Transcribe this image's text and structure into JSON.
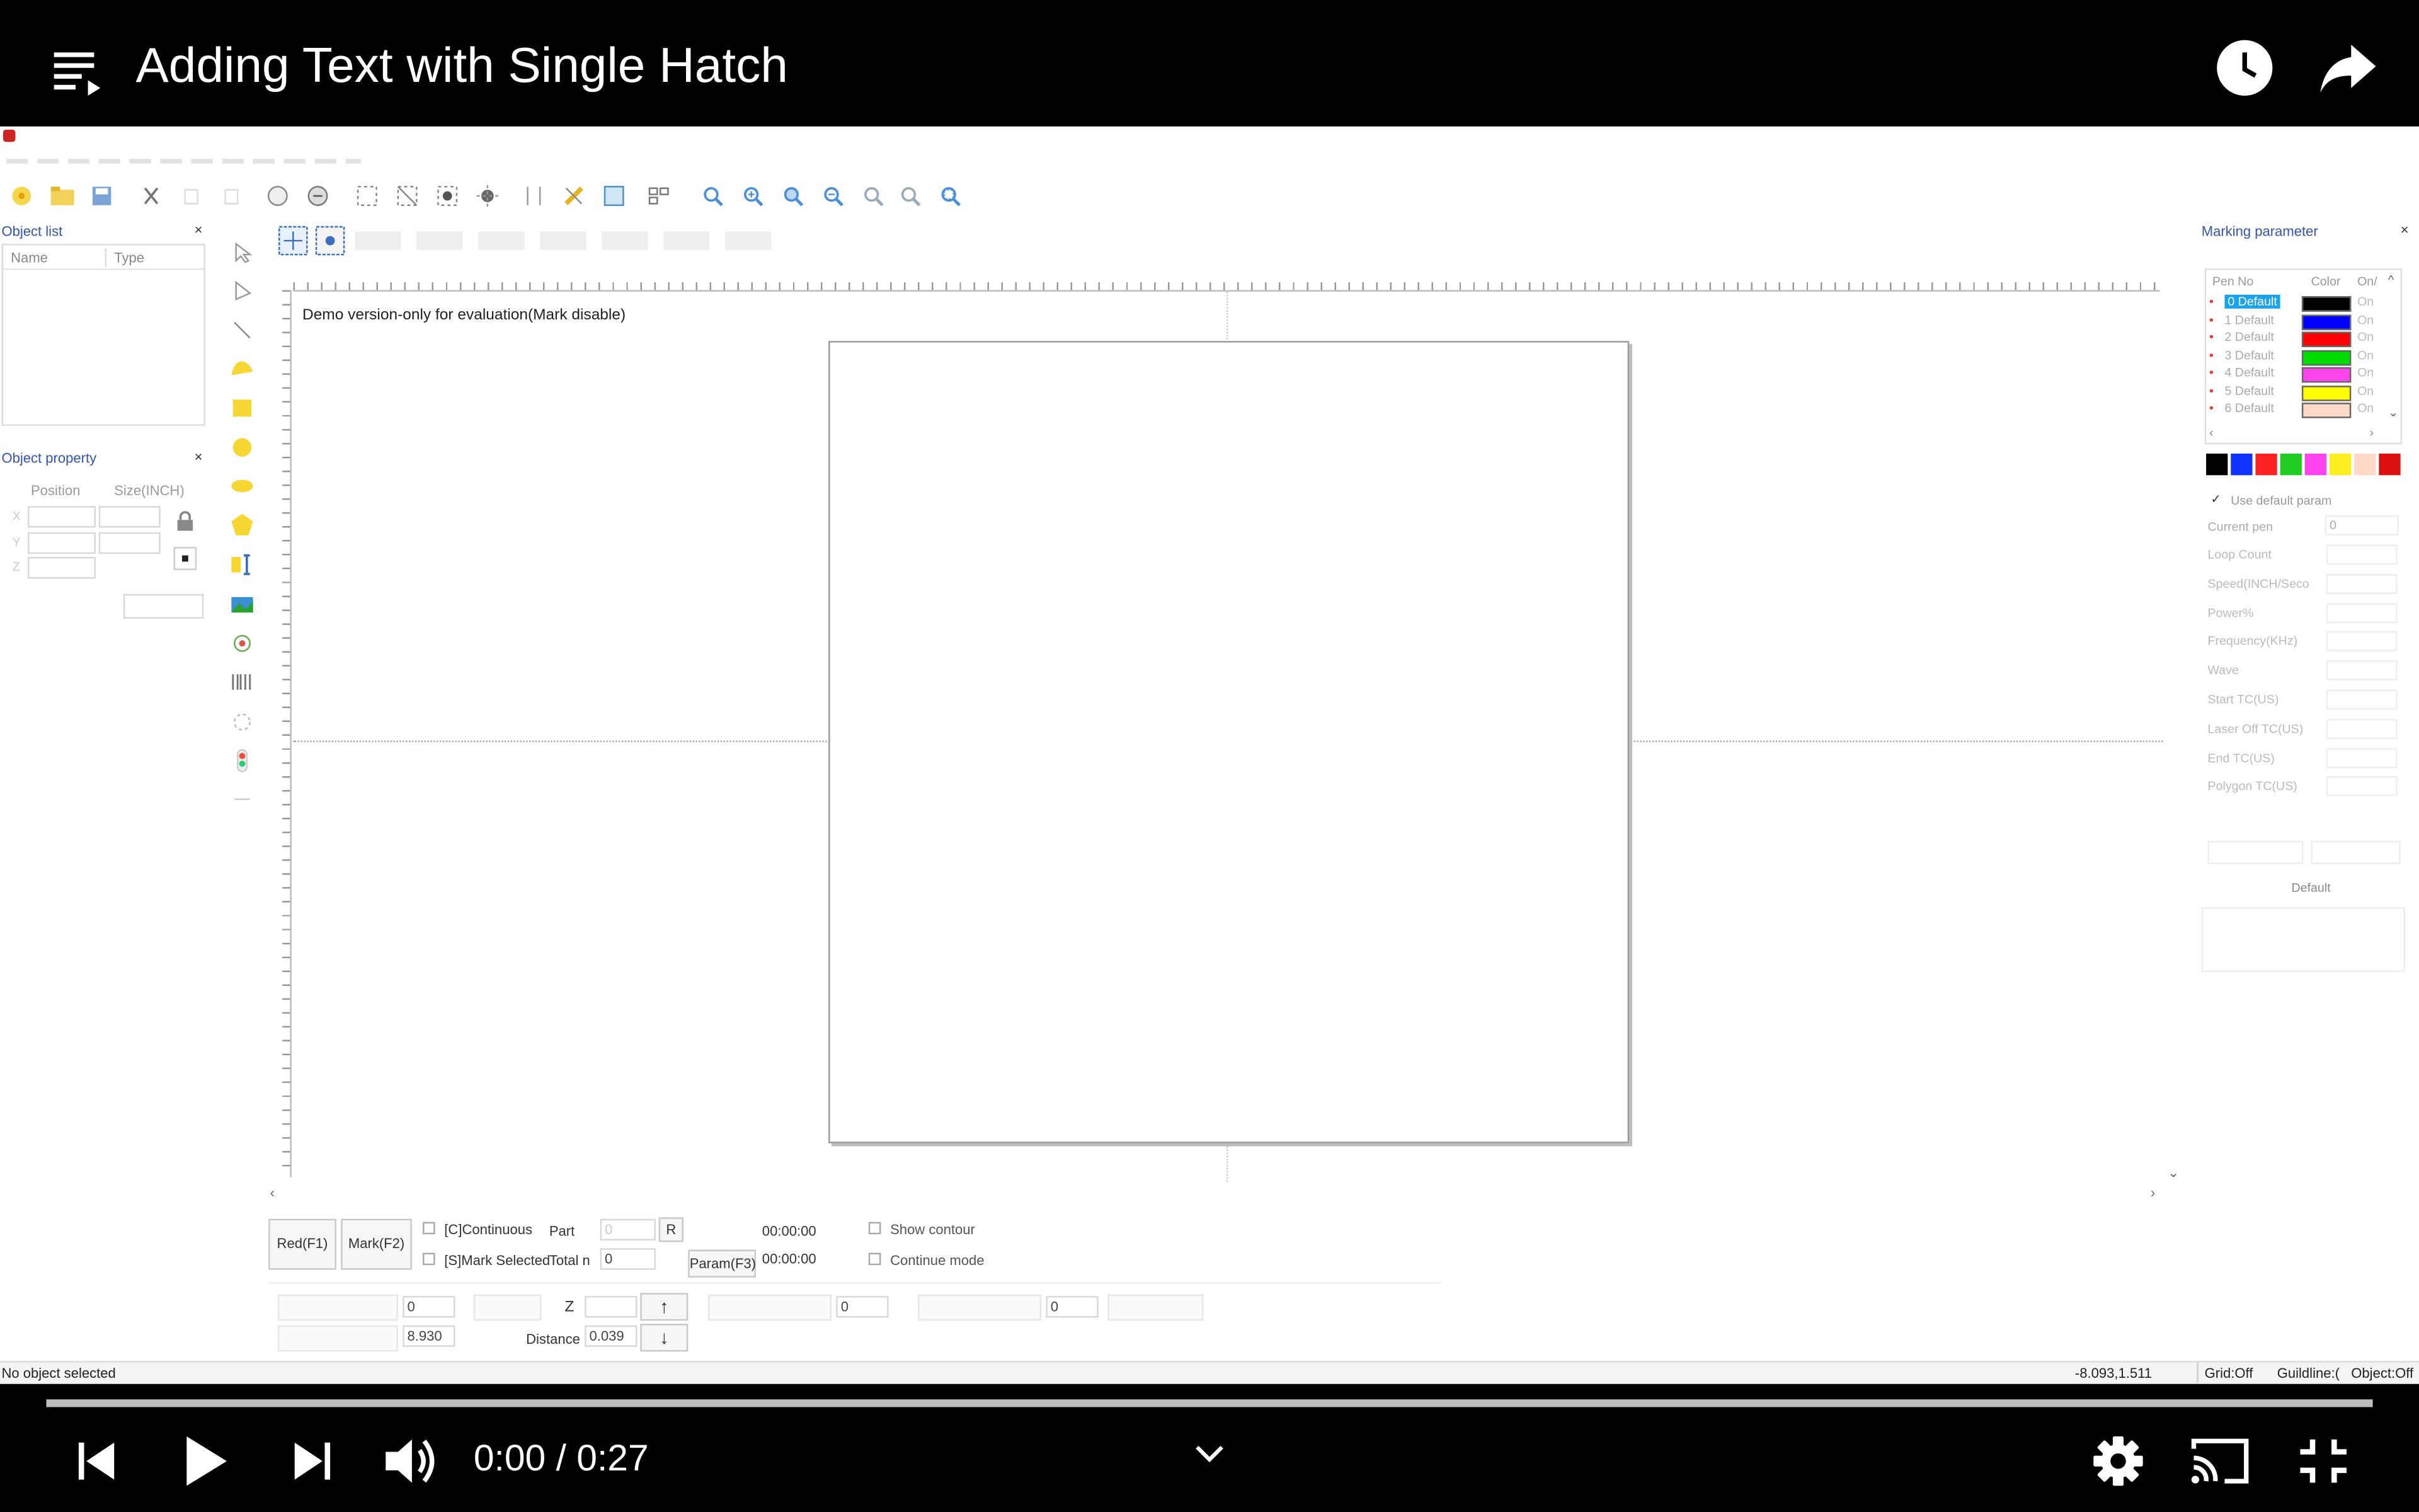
{
  "video": {
    "title": "Adding Text with Single Hatch",
    "current_time": "0:00",
    "duration": "0:27",
    "time_separator": " / ",
    "progress": 0
  },
  "app": {
    "watermark": "Demo version-only for evaluation(Mark disable)",
    "object_list": {
      "title": "Object list",
      "columns": [
        "Name",
        "Type"
      ]
    },
    "object_property": {
      "title": "Object property",
      "position_label": "Position",
      "size_label": "Size(INCH)",
      "axes": [
        "X",
        "Y",
        "Z"
      ]
    },
    "marking_parameter": {
      "title": "Marking parameter",
      "columns": [
        "Pen No",
        "Color",
        "On/"
      ],
      "pens": [
        {
          "name": "0 Default",
          "color": "#000000",
          "state": "On"
        },
        {
          "name": "1 Default",
          "color": "#0000ff",
          "state": "On"
        },
        {
          "name": "2 Default",
          "color": "#ff0000",
          "state": "On"
        },
        {
          "name": "3 Default",
          "color": "#00dd00",
          "state": "On"
        },
        {
          "name": "4 Default",
          "color": "#ff44ee",
          "state": "On"
        },
        {
          "name": "5 Default",
          "color": "#ffff00",
          "state": "On"
        },
        {
          "name": "6 Default",
          "color": "#ffd8c8",
          "state": "On"
        }
      ],
      "palette": [
        "#000000",
        "#1133ff",
        "#ff2222",
        "#22cc22",
        "#ff44ee",
        "#ffee22",
        "#ffd8c8",
        "#dd1111"
      ],
      "use_default_label": "Use default param",
      "current_pen_label": "Current pen",
      "current_pen_value": "0",
      "params": [
        "Loop Count",
        "Speed(INCH/Seco",
        "Power%",
        "Frequency(KHz)",
        "Wave",
        "Start TC(US)",
        "Laser Off TC(US)",
        "End TC(US)",
        "Polygon TC(US)"
      ],
      "default_button": "Default"
    },
    "bottom": {
      "red_button": "Red(F1)",
      "mark_button": "Mark(F2)",
      "continuous_label": "[C]Continuous",
      "mark_selected_label": "[S]Mark Selected",
      "part_label": "Part",
      "part_value": "0",
      "r_button": "R",
      "total_label": "Total n",
      "total_value": "0",
      "time1": "00:00:00",
      "time2": "00:00:00",
      "param_button": "Param(F3)",
      "show_contour_label": "Show contour",
      "continue_mode_label": "Continue mode",
      "field1_value": "0",
      "field2_value": "8.930",
      "z_label": "Z",
      "distance_label": "Distance",
      "distance_value": "0.039",
      "field3_value": "0",
      "field4_value": "0"
    },
    "status": {
      "message": "No object selected",
      "coords": "-8.093,1.511",
      "grid": "Grid:Off",
      "guideline": "Guildline:(",
      "object": "Object:Off"
    }
  }
}
